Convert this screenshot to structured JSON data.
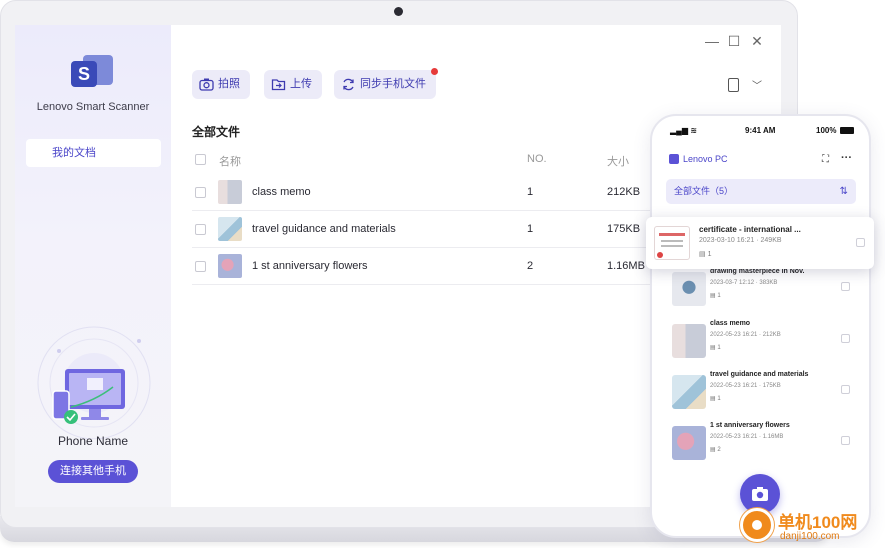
{
  "app": {
    "name": "Lenovo Smart Scanner"
  },
  "sidebar": {
    "nav_items": [
      {
        "label": "我的文档",
        "active": true
      }
    ],
    "phone_name": "Phone Name",
    "connect_button": "连接其他手机"
  },
  "window_controls": {
    "minimize": "—",
    "maximize": "☐",
    "close": "✕"
  },
  "toolbar": {
    "capture_label": "拍照",
    "upload_label": "上传",
    "sync_label": "同步手机文件",
    "sync_notification": true
  },
  "files": {
    "section_title": "全部文件",
    "columns": {
      "name": "名称",
      "no": "NO.",
      "size": "大小"
    },
    "rows": [
      {
        "name": "class memo",
        "no": "1",
        "size": "212KB",
        "thumb": "memo"
      },
      {
        "name": "travel guidance and materials",
        "no": "1",
        "size": "175KB",
        "thumb": "travel"
      },
      {
        "name": "1 st anniversary flowers",
        "no": "2",
        "size": "1.16MB",
        "thumb": "flowers"
      }
    ]
  },
  "phone": {
    "status_time": "9:41 AM",
    "battery": "100%",
    "brand": "Lenovo PC",
    "all_files_label": "全部文件（5）",
    "popped_item": {
      "title": "certificate - international ...",
      "date": "2023-03-10 16:21",
      "size": "249KB",
      "pages": "1"
    },
    "items": [
      {
        "title": "drawing masterpiece in Nov.",
        "date": "2023-03-7 12:12",
        "size": "383KB",
        "pages": "1"
      },
      {
        "title": "class memo",
        "date": "2022-05-23 16:21",
        "size": "212KB",
        "pages": "1"
      },
      {
        "title": "travel guidance and materials",
        "date": "2022-05-23 16:21",
        "size": "175KB",
        "pages": "1"
      },
      {
        "title": "1 st anniversary flowers",
        "date": "2022-05-23 16:21",
        "size": "1.16MB",
        "pages": "2"
      }
    ]
  },
  "watermark": {
    "title": "单机100网",
    "url": "danji100.com"
  },
  "colors": {
    "accent": "#5b52d6",
    "sidebar_bg": "#ecebfb",
    "notification": "#e63a3a",
    "watermark": "#f08a1c"
  }
}
